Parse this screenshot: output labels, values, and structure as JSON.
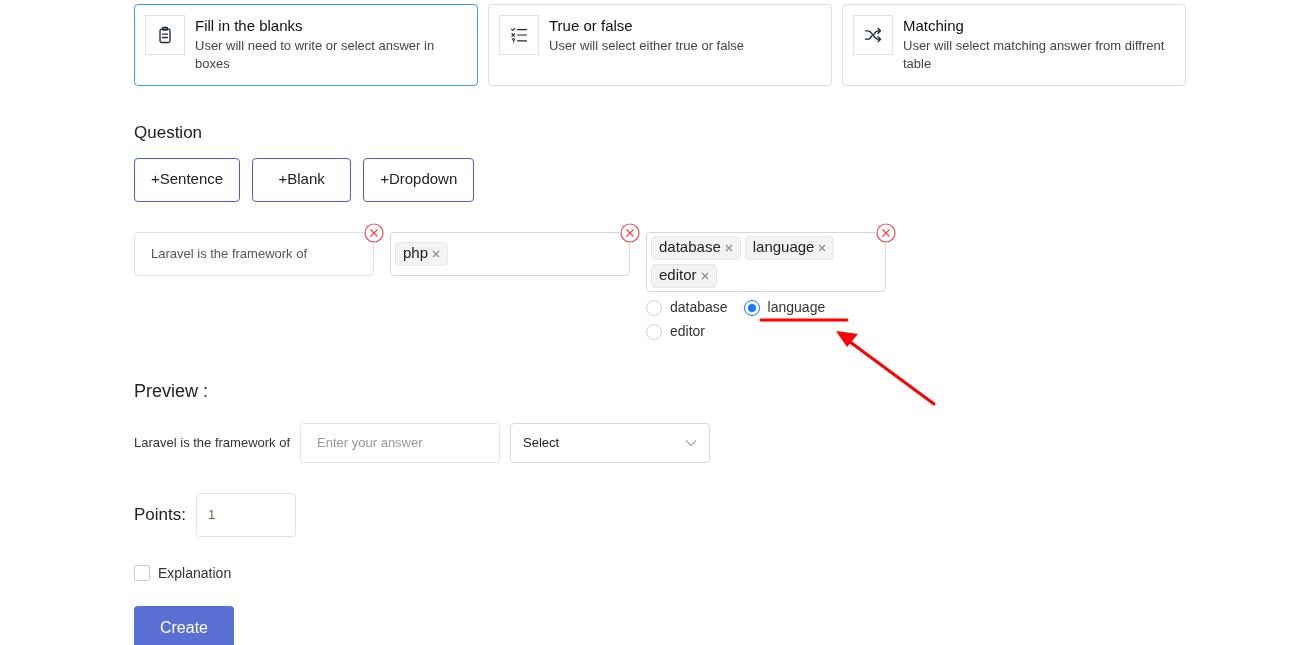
{
  "question_types": [
    {
      "kind": "clipboard",
      "title": "Fill in the blanks",
      "description": "User will need to write or select answer in boxes",
      "selected": true
    },
    {
      "kind": "list",
      "title": "True or false",
      "description": "User will select either true or false",
      "selected": false
    },
    {
      "kind": "shuffle",
      "title": "Matching",
      "description": "User will select matching answer from diffrent table",
      "selected": false
    }
  ],
  "question": {
    "heading": "Question",
    "add_buttons": [
      "+Sentence",
      "+Blank",
      "+Dropdown"
    ],
    "blocks": [
      {
        "kind": "sentence",
        "text": "Laravel is the framework of"
      },
      {
        "kind": "blank",
        "tags": [
          "php"
        ]
      },
      {
        "kind": "dropdown",
        "tags": [
          "database",
          "language",
          "editor"
        ],
        "options": [
          {
            "label": "database",
            "selected": false
          },
          {
            "label": "language",
            "selected": true
          },
          {
            "label": "editor",
            "selected": false
          }
        ]
      }
    ]
  },
  "preview": {
    "heading": "Preview :",
    "sentence": "Laravel is the framework of",
    "answer_placeholder": "Enter your answer",
    "select_value": "Select"
  },
  "points": {
    "label": "Points:",
    "value": "1"
  },
  "explanation": {
    "label": "Explanation",
    "checked": false
  },
  "create_button": "Create"
}
